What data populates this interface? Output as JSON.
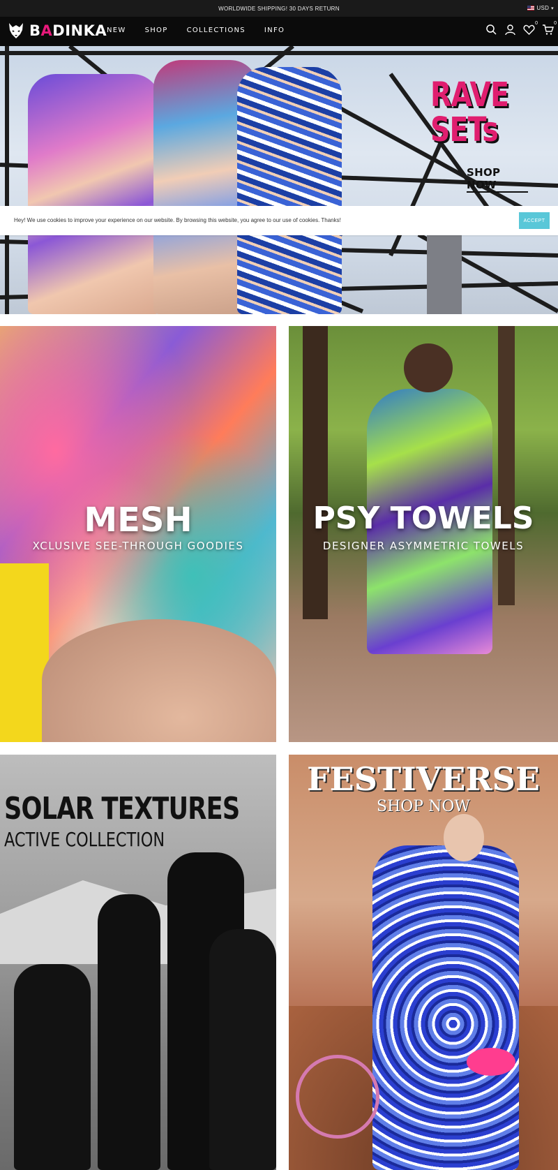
{
  "announcement": {
    "text": "WORLDWIDE SHIPPING! 30 DAYS RETURN",
    "currency": "USD"
  },
  "header": {
    "logo_prefix": "B",
    "logo_accent": "A",
    "logo_suffix": "DINKA",
    "nav": [
      "NEW",
      "SHOP",
      "COLLECTIONS",
      "INFO"
    ],
    "wishlist_count": "0",
    "cart_count": "0",
    "icons": [
      "search-icon",
      "account-icon",
      "wishlist-icon",
      "cart-icon"
    ]
  },
  "hero": {
    "headline_line1": "RAVE",
    "headline_line2": "SETs",
    "cta": "SHOP NOW",
    "accent_color": "#e01e6f"
  },
  "cookie": {
    "text": "Hey! We use cookies to improve your experience on our website. By browsing this website, you agree to our use of cookies. Thanks!",
    "button": "ACCEPT",
    "button_color": "#59c7d8"
  },
  "tiles": [
    {
      "title": "MESH",
      "subtitle": "XCLUSIVE SEE-THROUGH GOODIES"
    },
    {
      "title": "PSY TOWELS",
      "subtitle": "DESIGNER ASYMMETRIC TOWELS"
    },
    {
      "title": "SOLAR TEXTURES",
      "subtitle": "ACTIVE COLLECTION"
    },
    {
      "title": "FESTIVERSE",
      "subtitle": "SHOP NOW"
    }
  ]
}
